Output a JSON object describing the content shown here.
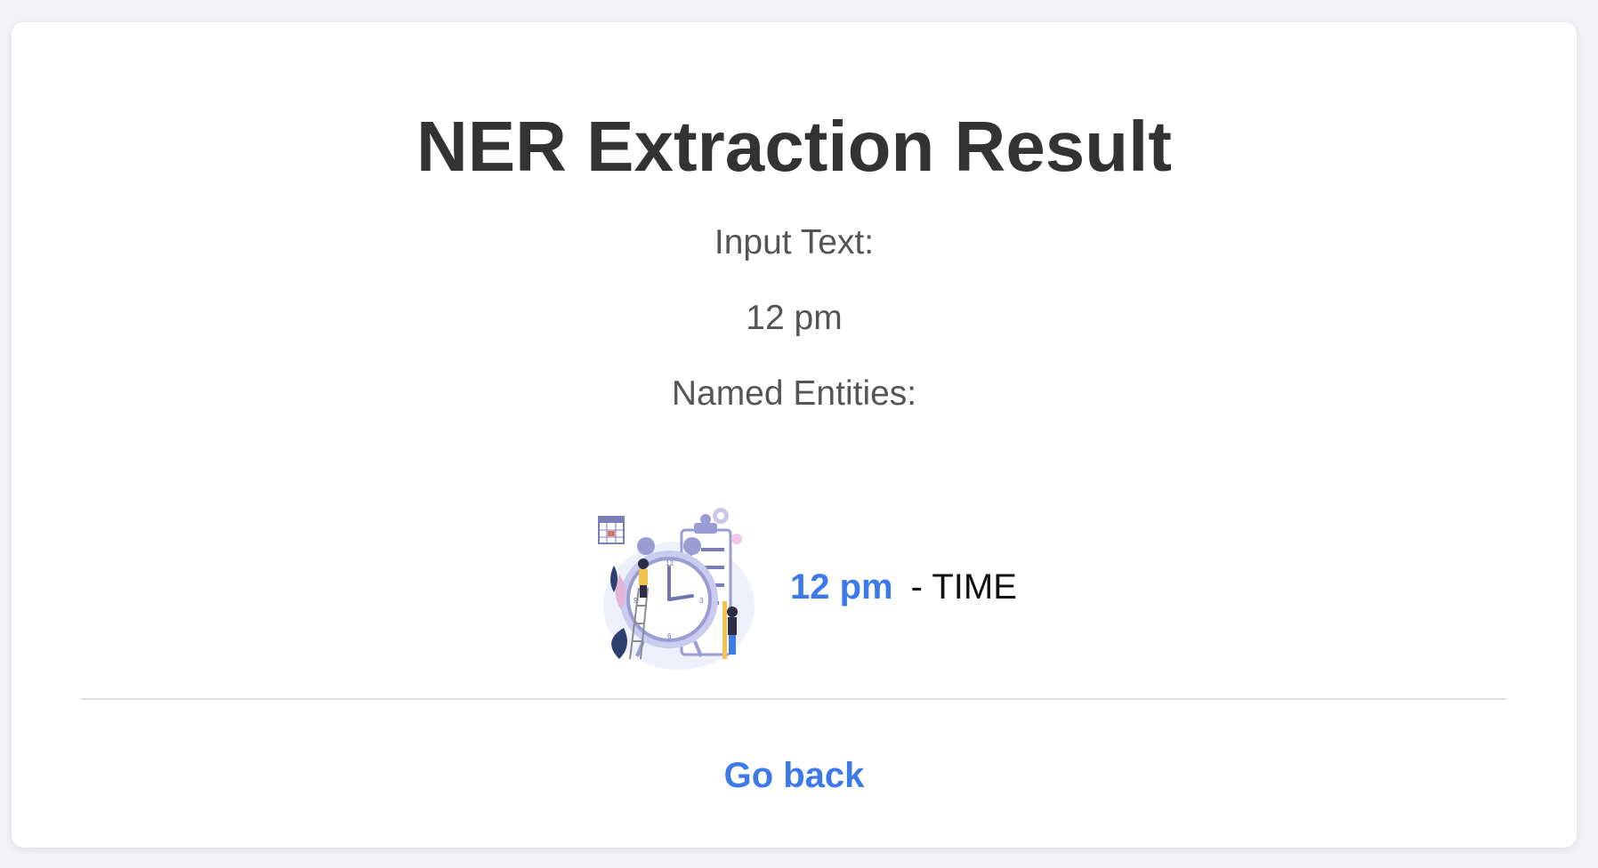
{
  "page": {
    "title": "NER Extraction Result",
    "input_label": "Input Text:",
    "input_value": "12 pm",
    "entities_label": "Named Entities:"
  },
  "entities": [
    {
      "text": "12 pm",
      "separator": "- ",
      "type": "TIME",
      "icon": "time-schedule-illustration"
    }
  ],
  "footer": {
    "back_label": "Go back"
  },
  "colors": {
    "background": "#f3f3f7",
    "card": "#ffffff",
    "title": "#333333",
    "accent": "#3b7ae8"
  }
}
